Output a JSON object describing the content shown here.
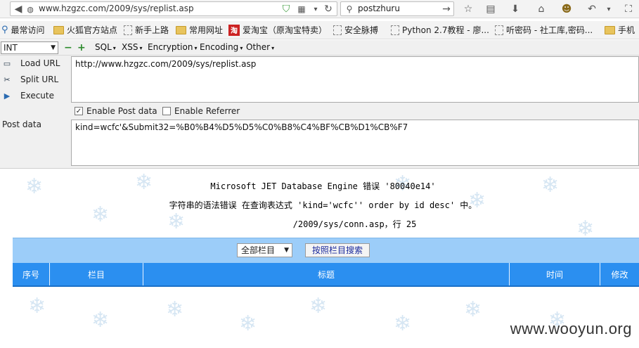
{
  "browser": {
    "url": "www.hzgzc.com/2009/sys/replist.asp",
    "search_value": "postzhuru"
  },
  "bookmarks": [
    {
      "label": "最常访问",
      "icon": "most-visited-icon"
    },
    {
      "label": "火狐官方站点",
      "icon": "folder-icon"
    },
    {
      "label": "新手上路",
      "icon": "page-icon"
    },
    {
      "label": "常用网址",
      "icon": "folder-icon"
    },
    {
      "label": "爱淘宝（原淘宝特卖）",
      "icon": "taobao-icon"
    },
    {
      "label": "安全脉搏",
      "icon": "page-icon"
    },
    {
      "label": "Python 2.7教程 - 廖...",
      "icon": "page-icon"
    },
    {
      "label": "听密码 - 社工库,密码...",
      "icon": "page-icon"
    },
    {
      "label": "手机",
      "icon": "folder-icon"
    }
  ],
  "hackbar": {
    "encoding_select": "INT",
    "menus": [
      "SQL",
      "XSS",
      "Encryption",
      "Encoding",
      "Other"
    ],
    "actions": [
      "Load URL",
      "Split URL",
      "Execute"
    ],
    "url_value": "http://www.hzgzc.com/2009/sys/replist.asp",
    "enable_post_label": "Enable Post data",
    "enable_post_checked": true,
    "enable_referrer_label": "Enable Referrer",
    "enable_referrer_checked": false,
    "post_label": "Post data",
    "post_value": "kind=wcfc'&Submit32=%B0%B4%D5%D5%C0%B8%C4%BF%CB%D1%CB%F7"
  },
  "page": {
    "error_line1": "Microsoft JET Database Engine 错误 '80040e14'",
    "error_line2": "字符串的语法错误 在查询表达式 'kind='wcfc'' order by id desc' 中。",
    "error_line3": "/2009/sys/conn.asp，行 25",
    "category_select": "全部栏目",
    "search_button": "按照栏目搜索",
    "columns": [
      "序号",
      "栏目",
      "标题",
      "时间",
      "修改"
    ]
  },
  "watermark": "www.wooyun.org"
}
